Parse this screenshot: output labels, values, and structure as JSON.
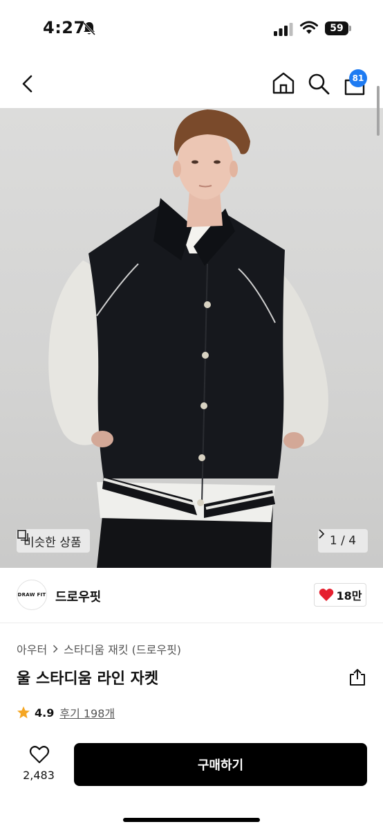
{
  "status_bar": {
    "time": "4:27",
    "battery": "59",
    "icons": [
      "bell-slash-icon",
      "signal-icon",
      "wifi-icon",
      "battery-icon"
    ]
  },
  "nav": {
    "icons": [
      "back-icon",
      "home-icon",
      "search-icon",
      "cart-icon"
    ],
    "cart_badge": "81"
  },
  "gallery": {
    "similar_label": "비슷한 상품",
    "page_indicator": "1 / 4"
  },
  "brand": {
    "logo_text": "DRAW FIT",
    "name": "드로우핏",
    "like_count": "18만"
  },
  "product": {
    "breadcrumb": [
      "아우터",
      "스타디움 재킷 (드로우핏)"
    ],
    "title": "울 스타디움 라인 자켓",
    "rating": "4.9",
    "reviews": "후기 198개"
  },
  "bottom_bar": {
    "wish_count": "2,483",
    "buy_label": "구매하기"
  },
  "colors": {
    "accent_badge": "#1e7bf2",
    "heart": "#e5202f",
    "star": "#f5a623",
    "buy_button": "#000000"
  }
}
